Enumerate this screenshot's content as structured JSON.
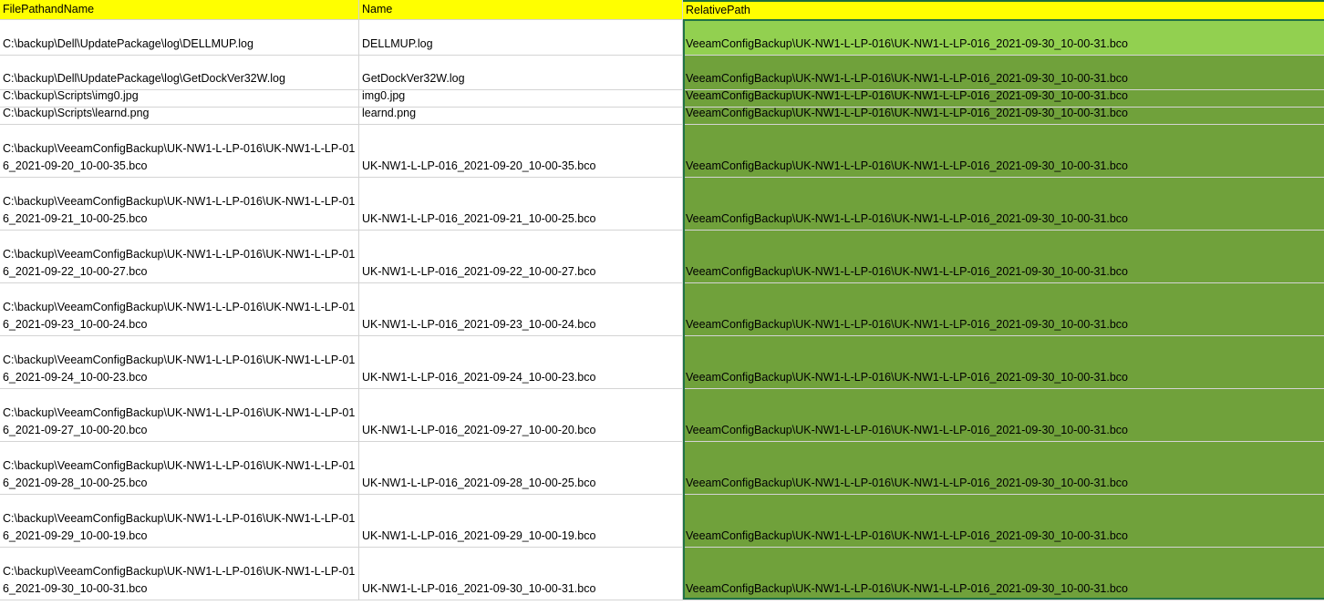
{
  "headers": [
    "FilePathandName",
    "Name",
    "RelativePath"
  ],
  "rows": [
    {
      "path": "C:\\backup\\Dell\\UpdatePackage\\log\\DELLMUP.log",
      "name": "DELLMUP.log",
      "rel": "VeeamConfigBackup\\UK-NW1-L-LP-016\\UK-NW1-L-LP-016_2021-09-30_10-00-31.bco"
    },
    {
      "path": "C:\\backup\\Dell\\UpdatePackage\\log\\GetDockVer32W.log",
      "name": "GetDockVer32W.log",
      "rel": "VeeamConfigBackup\\UK-NW1-L-LP-016\\UK-NW1-L-LP-016_2021-09-30_10-00-31.bco"
    },
    {
      "path": "C:\\backup\\Scripts\\img0.jpg",
      "name": "img0.jpg",
      "rel": "VeeamConfigBackup\\UK-NW1-L-LP-016\\UK-NW1-L-LP-016_2021-09-30_10-00-31.bco"
    },
    {
      "path": "C:\\backup\\Scripts\\learnd.png",
      "name": "learnd.png",
      "rel": "VeeamConfigBackup\\UK-NW1-L-LP-016\\UK-NW1-L-LP-016_2021-09-30_10-00-31.bco"
    },
    {
      "path": "C:\\backup\\VeeamConfigBackup\\UK-NW1-L-LP-016\\UK-NW1-L-LP-016_2021-09-20_10-00-35.bco",
      "name": "UK-NW1-L-LP-016_2021-09-20_10-00-35.bco",
      "rel": "VeeamConfigBackup\\UK-NW1-L-LP-016\\UK-NW1-L-LP-016_2021-09-30_10-00-31.bco"
    },
    {
      "path": "C:\\backup\\VeeamConfigBackup\\UK-NW1-L-LP-016\\UK-NW1-L-LP-016_2021-09-21_10-00-25.bco",
      "name": "UK-NW1-L-LP-016_2021-09-21_10-00-25.bco",
      "rel": "VeeamConfigBackup\\UK-NW1-L-LP-016\\UK-NW1-L-LP-016_2021-09-30_10-00-31.bco"
    },
    {
      "path": "C:\\backup\\VeeamConfigBackup\\UK-NW1-L-LP-016\\UK-NW1-L-LP-016_2021-09-22_10-00-27.bco",
      "name": "UK-NW1-L-LP-016_2021-09-22_10-00-27.bco",
      "rel": "VeeamConfigBackup\\UK-NW1-L-LP-016\\UK-NW1-L-LP-016_2021-09-30_10-00-31.bco"
    },
    {
      "path": "C:\\backup\\VeeamConfigBackup\\UK-NW1-L-LP-016\\UK-NW1-L-LP-016_2021-09-23_10-00-24.bco",
      "name": "UK-NW1-L-LP-016_2021-09-23_10-00-24.bco",
      "rel": "VeeamConfigBackup\\UK-NW1-L-LP-016\\UK-NW1-L-LP-016_2021-09-30_10-00-31.bco"
    },
    {
      "path": "C:\\backup\\VeeamConfigBackup\\UK-NW1-L-LP-016\\UK-NW1-L-LP-016_2021-09-24_10-00-23.bco",
      "name": "UK-NW1-L-LP-016_2021-09-24_10-00-23.bco",
      "rel": "VeeamConfigBackup\\UK-NW1-L-LP-016\\UK-NW1-L-LP-016_2021-09-30_10-00-31.bco"
    },
    {
      "path": "C:\\backup\\VeeamConfigBackup\\UK-NW1-L-LP-016\\UK-NW1-L-LP-016_2021-09-27_10-00-20.bco",
      "name": "UK-NW1-L-LP-016_2021-09-27_10-00-20.bco",
      "rel": "VeeamConfigBackup\\UK-NW1-L-LP-016\\UK-NW1-L-LP-016_2021-09-30_10-00-31.bco"
    },
    {
      "path": "C:\\backup\\VeeamConfigBackup\\UK-NW1-L-LP-016\\UK-NW1-L-LP-016_2021-09-28_10-00-25.bco",
      "name": "UK-NW1-L-LP-016_2021-09-28_10-00-25.bco",
      "rel": "VeeamConfigBackup\\UK-NW1-L-LP-016\\UK-NW1-L-LP-016_2021-09-30_10-00-31.bco"
    },
    {
      "path": "C:\\backup\\VeeamConfigBackup\\UK-NW1-L-LP-016\\UK-NW1-L-LP-016_2021-09-29_10-00-19.bco",
      "name": "UK-NW1-L-LP-016_2021-09-29_10-00-19.bco",
      "rel": "VeeamConfigBackup\\UK-NW1-L-LP-016\\UK-NW1-L-LP-016_2021-09-30_10-00-31.bco"
    },
    {
      "path": "C:\\backup\\VeeamConfigBackup\\UK-NW1-L-LP-016\\UK-NW1-L-LP-016_2021-09-30_10-00-31.bco",
      "name": "UK-NW1-L-LP-016_2021-09-30_10-00-31.bco",
      "rel": "VeeamConfigBackup\\UK-NW1-L-LP-016\\UK-NW1-L-LP-016_2021-09-30_10-00-31.bco"
    }
  ]
}
